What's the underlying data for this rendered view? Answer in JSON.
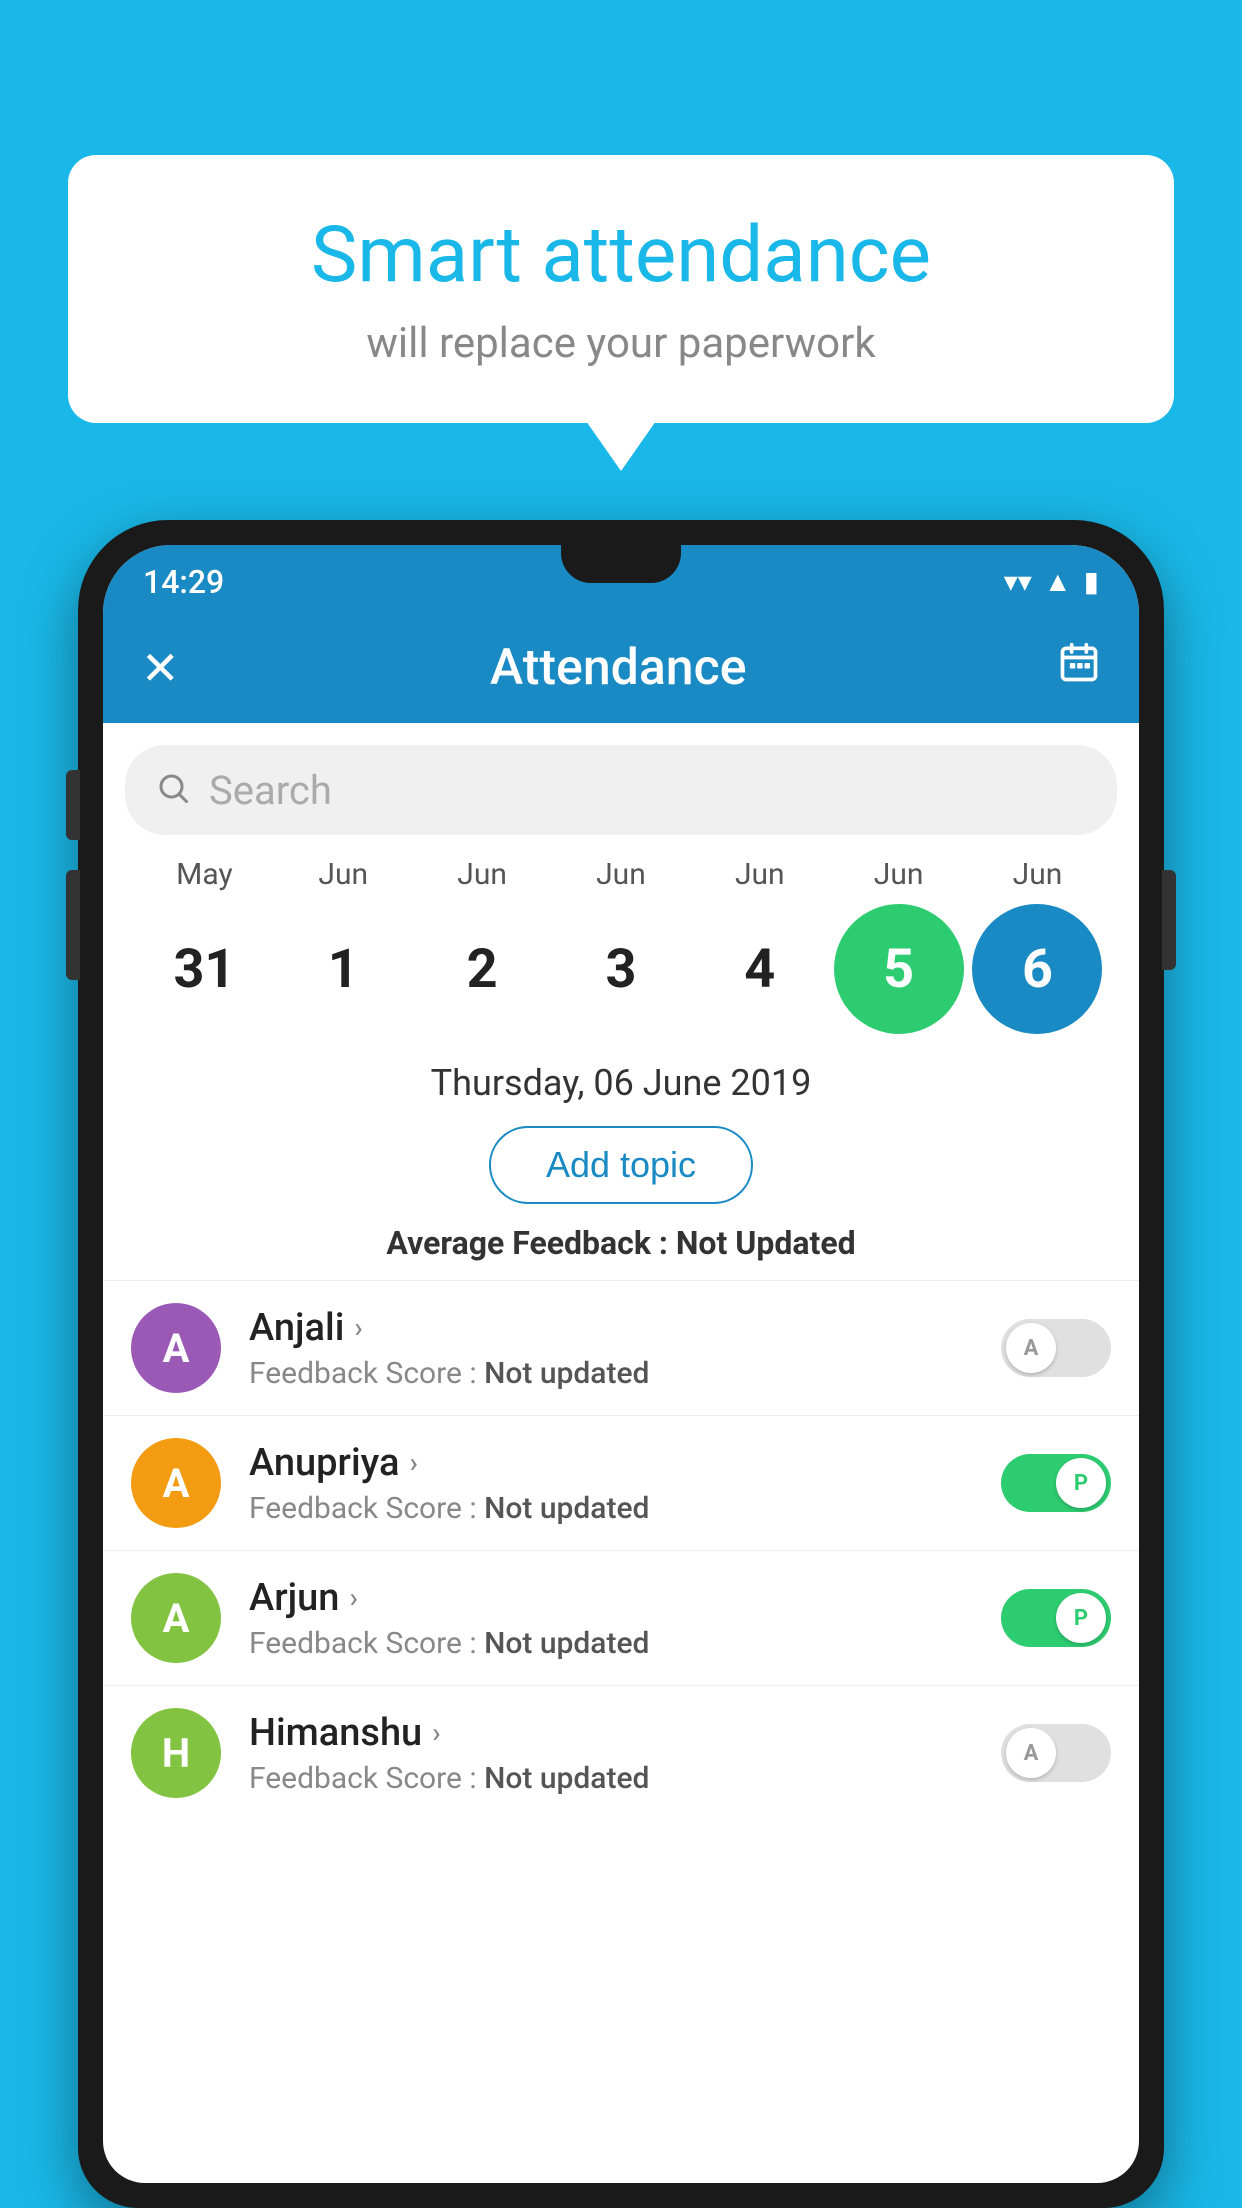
{
  "background_color": "#1ab8e8",
  "speech_bubble": {
    "title": "Smart attendance",
    "subtitle": "will replace your paperwork"
  },
  "status_bar": {
    "time": "14:29",
    "wifi": "▼",
    "signal": "▲",
    "battery": "▮"
  },
  "app_bar": {
    "title": "Attendance",
    "close_label": "✕",
    "calendar_icon": "📅"
  },
  "search": {
    "placeholder": "Search"
  },
  "calendar": {
    "months": [
      "May",
      "Jun",
      "Jun",
      "Jun",
      "Jun",
      "Jun",
      "Jun"
    ],
    "dates": [
      "31",
      "1",
      "2",
      "3",
      "4",
      "5",
      "6"
    ],
    "today_index": 5,
    "selected_index": 6
  },
  "selected_date_label": "Thursday, 06 June 2019",
  "add_topic_label": "Add topic",
  "feedback_summary": {
    "label": "Average Feedback : ",
    "value": "Not Updated"
  },
  "students": [
    {
      "name": "Anjali",
      "avatar_letter": "A",
      "avatar_color": "#9b59b6",
      "feedback": "Feedback Score : Not updated",
      "toggle_state": "off",
      "toggle_label": "A"
    },
    {
      "name": "Anupriya",
      "avatar_letter": "A",
      "avatar_color": "#f39c12",
      "feedback": "Feedback Score : Not updated",
      "toggle_state": "on",
      "toggle_label": "P"
    },
    {
      "name": "Arjun",
      "avatar_letter": "A",
      "avatar_color": "#82c341",
      "feedback": "Feedback Score : Not updated",
      "toggle_state": "on",
      "toggle_label": "P"
    },
    {
      "name": "Himanshu",
      "avatar_letter": "H",
      "avatar_color": "#82c341",
      "feedback": "Feedback Score : Not updated",
      "toggle_state": "off",
      "toggle_label": "A"
    }
  ]
}
